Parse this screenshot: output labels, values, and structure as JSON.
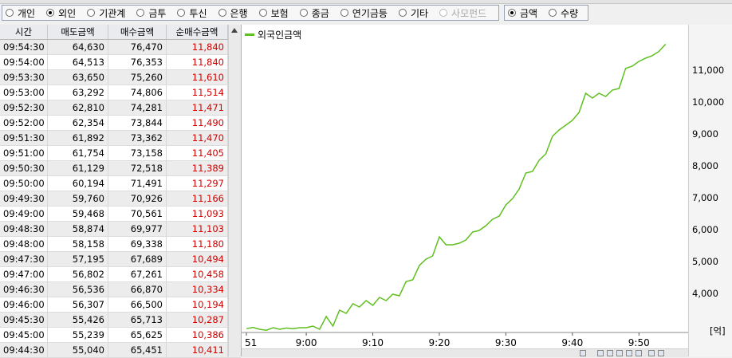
{
  "filter": {
    "investors": [
      {
        "label": "개인",
        "selected": false,
        "disabled": false
      },
      {
        "label": "외인",
        "selected": true,
        "disabled": false
      },
      {
        "label": "기관계",
        "selected": false,
        "disabled": false
      },
      {
        "label": "금투",
        "selected": false,
        "disabled": false
      },
      {
        "label": "투신",
        "selected": false,
        "disabled": false
      },
      {
        "label": "은행",
        "selected": false,
        "disabled": false
      },
      {
        "label": "보험",
        "selected": false,
        "disabled": false
      },
      {
        "label": "종금",
        "selected": false,
        "disabled": false
      },
      {
        "label": "연기금등",
        "selected": false,
        "disabled": false
      },
      {
        "label": "기타",
        "selected": false,
        "disabled": false
      },
      {
        "label": "사모펀드",
        "selected": false,
        "disabled": true
      }
    ],
    "units": [
      {
        "label": "금액",
        "selected": true,
        "disabled": false
      },
      {
        "label": "수량",
        "selected": false,
        "disabled": false
      }
    ]
  },
  "table": {
    "headers": [
      "시간",
      "매도금액",
      "매수금액",
      "순매수금액"
    ],
    "rows": [
      [
        "09:54:30",
        "64,630",
        "76,470",
        "11,840"
      ],
      [
        "09:54:00",
        "64,513",
        "76,353",
        "11,840"
      ],
      [
        "09:53:30",
        "63,650",
        "75,260",
        "11,610"
      ],
      [
        "09:53:00",
        "63,292",
        "74,806",
        "11,514"
      ],
      [
        "09:52:30",
        "62,810",
        "74,281",
        "11,471"
      ],
      [
        "09:52:00",
        "62,354",
        "73,844",
        "11,490"
      ],
      [
        "09:51:30",
        "61,892",
        "73,362",
        "11,470"
      ],
      [
        "09:51:00",
        "61,754",
        "73,158",
        "11,405"
      ],
      [
        "09:50:30",
        "61,129",
        "72,518",
        "11,389"
      ],
      [
        "09:50:00",
        "60,194",
        "71,491",
        "11,297"
      ],
      [
        "09:49:30",
        "59,760",
        "70,926",
        "11,166"
      ],
      [
        "09:49:00",
        "59,468",
        "70,561",
        "11,093"
      ],
      [
        "09:48:30",
        "58,874",
        "69,977",
        "11,103"
      ],
      [
        "09:48:00",
        "58,158",
        "69,338",
        "11,180"
      ],
      [
        "09:47:30",
        "57,195",
        "67,689",
        "10,494"
      ],
      [
        "09:47:00",
        "56,802",
        "67,261",
        "10,458"
      ],
      [
        "09:46:30",
        "56,536",
        "66,870",
        "10,334"
      ],
      [
        "09:46:00",
        "56,307",
        "66,500",
        "10,194"
      ],
      [
        "09:45:30",
        "55,426",
        "65,713",
        "10,287"
      ],
      [
        "09:45:00",
        "55,239",
        "65,625",
        "10,386"
      ],
      [
        "09:44:30",
        "55,040",
        "65,451",
        "10,411"
      ]
    ]
  },
  "chart_data": {
    "type": "line",
    "series": [
      {
        "name": "외국인금액",
        "color": "#5fbf1f"
      }
    ],
    "x_ticks": [
      "51",
      "9:00",
      "9:10",
      "9:20",
      "9:30",
      "9:40",
      "9:50"
    ],
    "y_ticks": [
      4000,
      5000,
      6000,
      7000,
      8000,
      9000,
      10000,
      11000
    ],
    "y_tick_labels": [
      "4,000",
      "5,000",
      "6,000",
      "7,000",
      "8,000",
      "9,000",
      "10,000",
      "11,000"
    ],
    "ylim": [
      2800,
      12000
    ],
    "x_minutes_range": [
      -9,
      55
    ],
    "unit": "[억]",
    "points": [
      [
        -9,
        2920
      ],
      [
        -8,
        2960
      ],
      [
        -7,
        2900
      ],
      [
        -6,
        2870
      ],
      [
        -5,
        2950
      ],
      [
        -4,
        2900
      ],
      [
        -3,
        2940
      ],
      [
        -2,
        2920
      ],
      [
        -1,
        2950
      ],
      [
        0,
        2950
      ],
      [
        1,
        3000
      ],
      [
        2,
        2900
      ],
      [
        3,
        3300
      ],
      [
        4,
        3000
      ],
      [
        5,
        3500
      ],
      [
        6,
        3400
      ],
      [
        7,
        3700
      ],
      [
        8,
        3600
      ],
      [
        9,
        3800
      ],
      [
        10,
        3650
      ],
      [
        11,
        3900
      ],
      [
        12,
        3800
      ],
      [
        13,
        4000
      ],
      [
        14,
        3950
      ],
      [
        15,
        4400
      ],
      [
        16,
        4450
      ],
      [
        17,
        4900
      ],
      [
        18,
        5100
      ],
      [
        19,
        5200
      ],
      [
        20,
        5800
      ],
      [
        21,
        5550
      ],
      [
        22,
        5550
      ],
      [
        23,
        5600
      ],
      [
        24,
        5700
      ],
      [
        25,
        5950
      ],
      [
        26,
        6000
      ],
      [
        27,
        6150
      ],
      [
        28,
        6350
      ],
      [
        29,
        6450
      ],
      [
        30,
        6800
      ],
      [
        31,
        7000
      ],
      [
        32,
        7300
      ],
      [
        33,
        7800
      ],
      [
        34,
        7850
      ],
      [
        35,
        8200
      ],
      [
        36,
        8400
      ],
      [
        37,
        8950
      ],
      [
        38,
        9150
      ],
      [
        39,
        9300
      ],
      [
        40,
        9450
      ],
      [
        41,
        9700
      ],
      [
        42,
        10300
      ],
      [
        43,
        10150
      ],
      [
        44,
        10300
      ],
      [
        45,
        10200
      ],
      [
        46,
        10400
      ],
      [
        47,
        10450
      ],
      [
        48,
        11080
      ],
      [
        49,
        11150
      ],
      [
        50,
        11300
      ],
      [
        51,
        11400
      ],
      [
        52,
        11480
      ],
      [
        53,
        11610
      ],
      [
        54,
        11840
      ]
    ]
  }
}
